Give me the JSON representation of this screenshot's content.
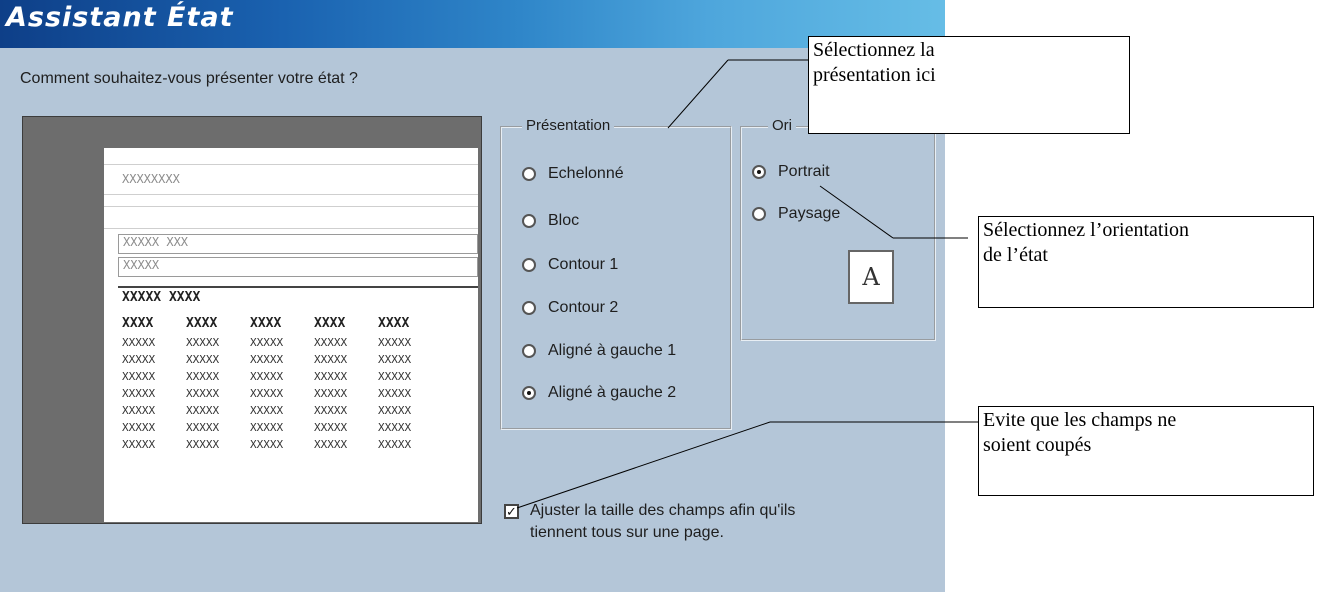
{
  "window": {
    "title": "Assistant État",
    "prompt": "Comment souhaitez-vous présenter votre état ?"
  },
  "preview": {
    "header_placeholder": "XXXXXXXX",
    "group_field_1": "XXXXX XXX",
    "group_field_2": "XXXXX",
    "column_header_title": "XXXXX XXXX",
    "columns": [
      "XXXX",
      "XXXX",
      "XXXX",
      "XXXX",
      "XXXX"
    ],
    "cell_text": "XXXXX",
    "row_count": 7
  },
  "layout_group": {
    "legend": "Présentation",
    "options": [
      {
        "label": "Echelonné",
        "selected": false
      },
      {
        "label": "Bloc",
        "selected": false
      },
      {
        "label": "Contour 1",
        "selected": false
      },
      {
        "label": "Contour 2",
        "selected": false
      },
      {
        "label": "Aligné à gauche 1",
        "selected": false
      },
      {
        "label": "Aligné à gauche 2",
        "selected": true
      }
    ]
  },
  "orientation_group": {
    "legend_partial": "Ori",
    "options": [
      {
        "label": "Portrait",
        "selected": true
      },
      {
        "label": "Paysage",
        "selected": false
      }
    ],
    "icon": "page-orientation-icon",
    "icon_letter": "A"
  },
  "fit_checkbox": {
    "label_line1": "Ajuster la taille des champs afin qu'ils",
    "label_line2": "tiennent tous sur une page.",
    "checked": true
  },
  "annotations": {
    "presentation": {
      "line1": "Sélectionnez la",
      "line2": "présentation ici"
    },
    "orientation": {
      "line1": "Sélectionnez l’orientation",
      "line2": "de l’état"
    },
    "fit": {
      "line1": "Evite que les champs ne",
      "line2": "soient coupés"
    }
  },
  "colors": {
    "dialog_bg": "#b4c6d8",
    "title_gradient_start": "#0e3f88",
    "title_gradient_end": "#66bde6"
  }
}
